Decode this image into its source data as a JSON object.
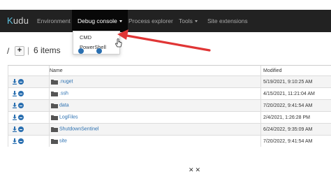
{
  "navbar": {
    "brand": "Kudu",
    "brand_first": "K",
    "brand_rest": "udu",
    "items": [
      {
        "label": "Environment"
      },
      {
        "label": "Debug console"
      },
      {
        "label": "Process explorer"
      },
      {
        "label": "Tools"
      },
      {
        "label": "Site extensions"
      }
    ]
  },
  "dropdown": {
    "items": [
      {
        "label": "CMD"
      },
      {
        "label": "PowerShell"
      }
    ]
  },
  "path": {
    "slash": "/",
    "add_label": "+",
    "separator": "|",
    "items_count": "6 items"
  },
  "table": {
    "columns": [
      "",
      "Name",
      "Modified"
    ],
    "rows": [
      {
        "name": ".nuget",
        "modified": "5/19/2021, 9:10:25 AM"
      },
      {
        "name": ".ssh",
        "modified": "4/15/2021, 11:21:04 AM"
      },
      {
        "name": "data",
        "modified": "7/20/2022, 9:41:54 AM"
      },
      {
        "name": "LogFiles",
        "modified": "2/4/2021, 1:26:28 PM"
      },
      {
        "name": "ShutdownSentinel",
        "modified": "6/24/2022, 9:35:09 AM"
      },
      {
        "name": "site",
        "modified": "7/20/2022, 9:41:54 AM"
      }
    ]
  },
  "colors": {
    "navbar": "#222222",
    "accent": "#2a6fb0",
    "arrow": "#e03535"
  }
}
